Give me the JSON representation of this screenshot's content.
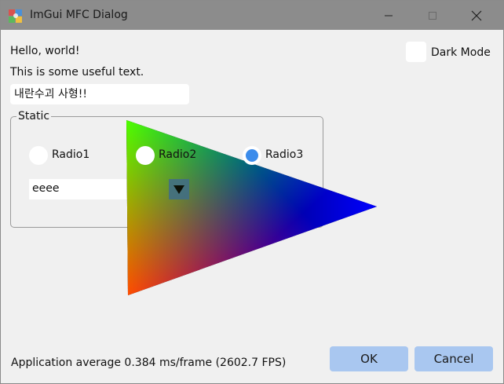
{
  "window": {
    "title": "ImGui MFC Dialog"
  },
  "content": {
    "hello_text": "Hello, world!",
    "useful_text": "This is some useful text.",
    "text_input_value": "내란수괴 사형!!",
    "group_label": "Static",
    "radios": [
      {
        "label": "Radio1",
        "checked": false
      },
      {
        "label": "Radio2",
        "checked": false
      },
      {
        "label": "Radio3",
        "checked": true
      }
    ],
    "combo_value": "eeee",
    "dark_mode_label": "Dark Mode",
    "dark_mode_checked": false,
    "status_text": "Application average 0.384 ms/frame (2602.7 FPS)"
  },
  "buttons": {
    "ok_label": "OK",
    "cancel_label": "Cancel"
  },
  "colors": {
    "titlebar": "#8c8c8c",
    "button": "#a9c7f0",
    "radio_selected": "#3c8ceb",
    "triangle_top": "#00ff00",
    "triangle_right": "#0000ff",
    "triangle_bottom": "#ff0000"
  }
}
